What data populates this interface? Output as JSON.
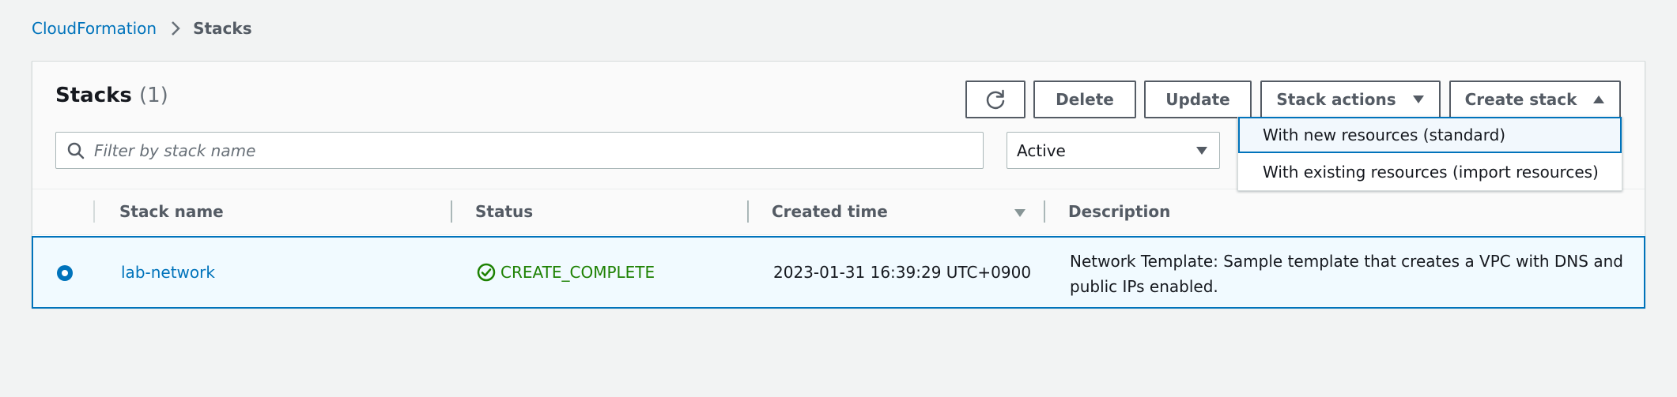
{
  "breadcrumb": {
    "link": "CloudFormation",
    "current": "Stacks"
  },
  "panel": {
    "title": "Stacks",
    "count": "(1)"
  },
  "toolbar": {
    "refresh_icon": "refresh-icon",
    "delete_label": "Delete",
    "update_label": "Update",
    "stack_actions_label": "Stack actions",
    "create_stack_label": "Create stack"
  },
  "filter": {
    "placeholder": "Filter by stack name",
    "value": "",
    "status_selected": "Active"
  },
  "table": {
    "columns": [
      "Stack name",
      "Status",
      "Created time",
      "Description"
    ],
    "sorted_column": "Created time",
    "sort_direction": "descending",
    "rows": [
      {
        "selected": true,
        "stack_name": "lab-network",
        "status": "CREATE_COMPLETE",
        "created_time": "2023-01-31 16:39:29 UTC+0900",
        "description_line1": "Network Template: Sample template that creates a VPC with DNS and",
        "description_line2": "public IPs enabled."
      }
    ]
  },
  "create_menu": {
    "open": true,
    "items": [
      {
        "label": "With new resources (standard)",
        "highlighted": true
      },
      {
        "label": "With existing resources (import resources)",
        "highlighted": false
      }
    ]
  },
  "colors": {
    "link": "#0073bb",
    "success": "#1d8102",
    "selected_row_bg": "#f1faff",
    "page_bg": "#f2f3f3"
  }
}
